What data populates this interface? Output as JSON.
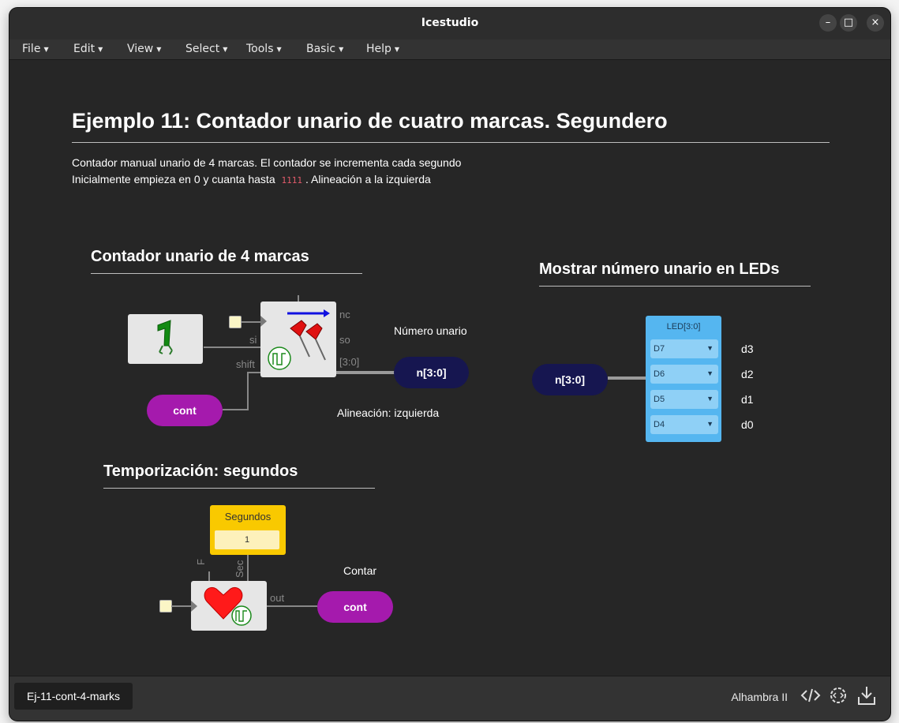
{
  "window": {
    "title": "Icestudio",
    "controls": [
      "minimize-icon",
      "maximize-icon",
      "close-icon"
    ]
  },
  "menu": [
    "File",
    "Edit",
    "View",
    "Select",
    "Tools",
    "Basic",
    "Help"
  ],
  "doc": {
    "title": "Ejemplo 11: Contador unario de cuatro marcas. Segundero",
    "line1": "Contador manual unario de 4 marcas. El contador se incrementa cada segundo",
    "line2_pre": "Inicialmente empieza en 0 y cuanta hasta",
    "line2_code": "1111",
    "line2_post": ". Alineación a la izquierda"
  },
  "sections": {
    "counter": "Contador unario de 4 marcas",
    "leds": "Mostrar número unario en LEDs",
    "timing": "Temporización: segundos"
  },
  "counter": {
    "const_icon": "green-one-icon",
    "ports": {
      "si": "si",
      "shift": "shift",
      "nc": "nc",
      "so": "so",
      "bus": "[3:0]"
    },
    "cont": "cont",
    "out_label": "Número unario",
    "out_name": "n[3:0]",
    "align": "Alineación: izquierda"
  },
  "leds": {
    "in_name": "n[3:0]",
    "block_title": "LED[3:0]",
    "pins": [
      "D7",
      "D6",
      "D5",
      "D4"
    ],
    "outputs": [
      "d3",
      "d2",
      "d1",
      "d0"
    ]
  },
  "timing": {
    "const_title": "Segundos",
    "const_value": "1",
    "ports": {
      "f": "F",
      "sec": "Sec",
      "out": "out"
    },
    "out_label": "Contar",
    "out_name": "cont"
  },
  "status": {
    "tab": "Ej-11-cont-4-marks",
    "board": "Alhambra II",
    "icons": [
      "code-icon",
      "gear-code-icon",
      "download-icon"
    ]
  }
}
